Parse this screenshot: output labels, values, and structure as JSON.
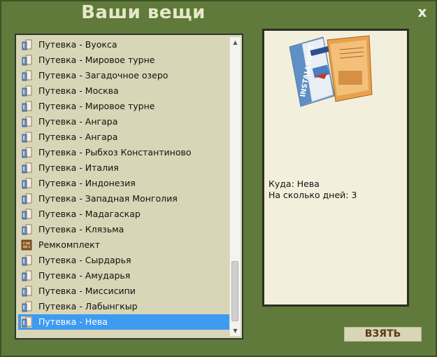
{
  "window": {
    "title": "Ваши вещи",
    "close_label": "x"
  },
  "inventory": {
    "items": [
      {
        "label": "Путевка - Вуокса",
        "icon": "voucher-icon"
      },
      {
        "label": "Путевка - Мировое турне",
        "icon": "voucher-icon"
      },
      {
        "label": "Путевка - Загадочное озеро",
        "icon": "voucher-icon"
      },
      {
        "label": "Путевка - Москва",
        "icon": "voucher-icon"
      },
      {
        "label": "Путевка - Мировое турне",
        "icon": "voucher-icon"
      },
      {
        "label": "Путевка - Ангара",
        "icon": "voucher-icon"
      },
      {
        "label": "Путевка - Ангара",
        "icon": "voucher-icon"
      },
      {
        "label": "Путевка - Рыбхоз Константиново",
        "icon": "voucher-icon"
      },
      {
        "label": "Путевка - Италия",
        "icon": "voucher-icon"
      },
      {
        "label": "Путевка - Индонезия",
        "icon": "voucher-icon"
      },
      {
        "label": "Путевка - Западная Монголия",
        "icon": "voucher-icon"
      },
      {
        "label": "Путевка - Мадагаскар",
        "icon": "voucher-icon"
      },
      {
        "label": "Путевка - Клязьма",
        "icon": "voucher-icon"
      },
      {
        "label": "Ремкомплект",
        "icon": "repair-kit-icon"
      },
      {
        "label": "Путевка - Сырдарья",
        "icon": "voucher-icon"
      },
      {
        "label": "Путевка - Амударья",
        "icon": "voucher-icon"
      },
      {
        "label": "Путевка - Миссисипи",
        "icon": "voucher-icon"
      },
      {
        "label": "Путевка - Лабынгкыр",
        "icon": "voucher-icon"
      },
      {
        "label": "Путевка - Нева",
        "icon": "voucher-icon",
        "selected": true
      }
    ]
  },
  "detail": {
    "image": "travel-brochure-image",
    "brochure_text": "INSTALLSOFT",
    "destination": "Куда: Нева",
    "days": "На сколько дней: 3"
  },
  "actions": {
    "take_label": "ВЗЯТЬ"
  },
  "colors": {
    "background": "#5f7a3a",
    "list_bg": "#d8d6b6",
    "selected": "#3d9bf2",
    "detail_bg": "#f2f0dc"
  }
}
